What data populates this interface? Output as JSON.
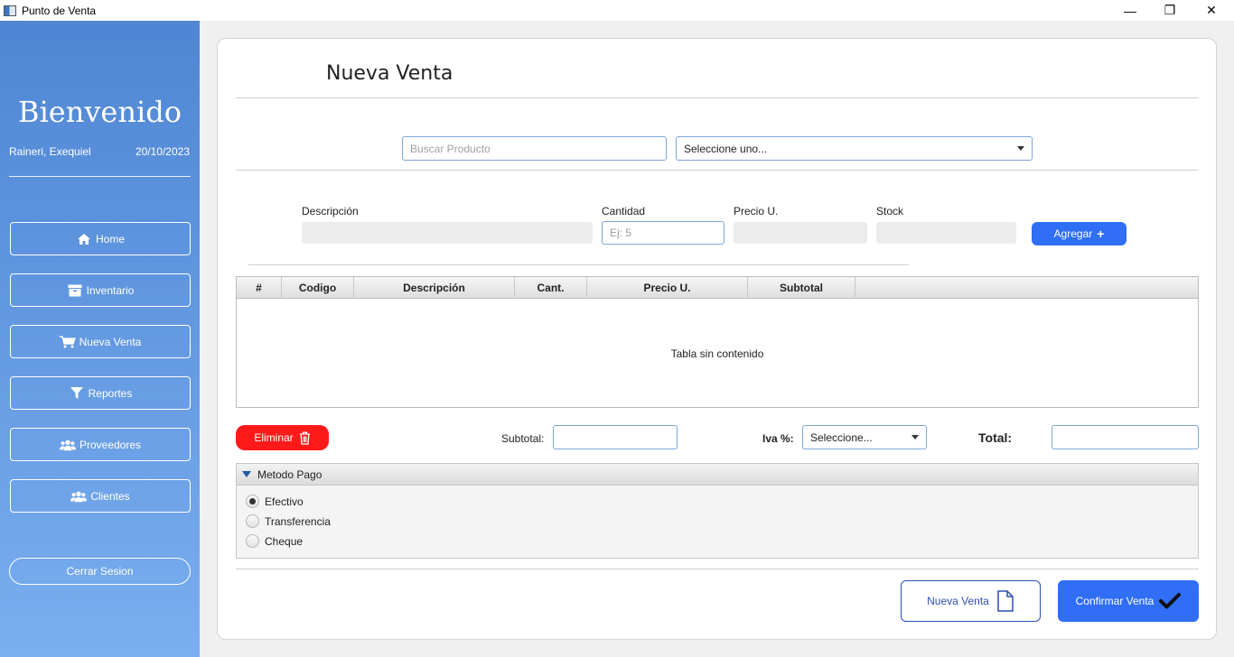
{
  "window": {
    "title": "Punto de Venta"
  },
  "sidebar": {
    "welcome": "Bienvenido",
    "user": "Raineri, Exequiel",
    "date": "20/10/2023",
    "nav": [
      {
        "label": "Home",
        "icon": "home-icon"
      },
      {
        "label": "Inventario",
        "icon": "archive-box-icon"
      },
      {
        "label": "Nueva Venta",
        "icon": "shopping-cart-icon"
      },
      {
        "label": "Reportes",
        "icon": "filter-icon"
      },
      {
        "label": "Proveedores",
        "icon": "users-group-icon"
      },
      {
        "label": "Clientes",
        "icon": "users-group-icon"
      }
    ],
    "logout": "Cerrar Sesion"
  },
  "main": {
    "title": "Nueva Venta",
    "search": {
      "placeholder": "Buscar Producto"
    },
    "product_select": {
      "value": "Seleccione uno..."
    },
    "fields": {
      "descripcion_label": "Descripción",
      "cantidad_label": "Cantidad",
      "cantidad_placeholder": "Ej: 5",
      "precio_label": "Precio U.",
      "stock_label": "Stock"
    },
    "add_button": "Agregar",
    "table": {
      "columns": [
        "#",
        "Codigo",
        "Descripción",
        "Cant.",
        "Precio U.",
        "Subtotal"
      ],
      "rows": [],
      "empty_text": "Tabla sin contenido"
    },
    "delete_button": "Eliminar",
    "subtotal_label": "Subtotal:",
    "iva_label": "Iva %:",
    "iva_select": {
      "value": "Seleccione..."
    },
    "total_label": "Total:",
    "payment": {
      "title": "Metodo Pago",
      "options": [
        "Efectivo",
        "Transferencia",
        "Cheque"
      ],
      "selected": "Efectivo"
    },
    "new_sale_button": "Nueva Venta",
    "confirm_button": "Confirmar Venta"
  },
  "colors": {
    "accent": "#2f6ef5",
    "danger": "#ff1a1a",
    "sidebar_top": "#4f86d3",
    "sidebar_bottom": "#7aaef0"
  }
}
